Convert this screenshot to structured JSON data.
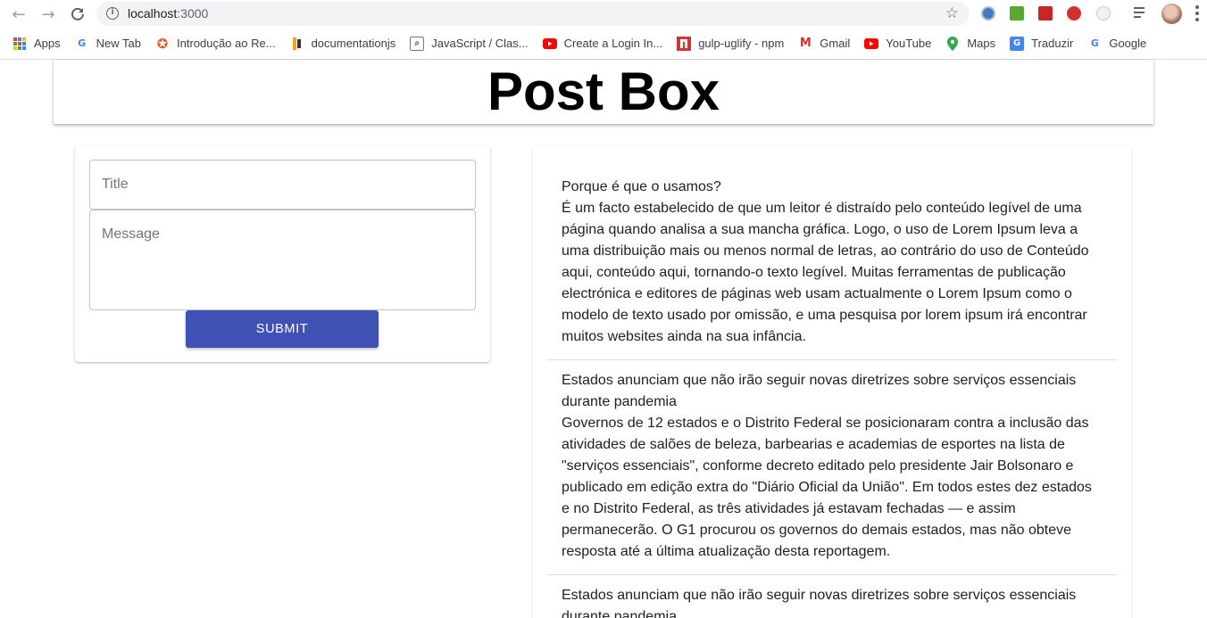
{
  "browser": {
    "url_host": "localhost",
    "url_port": ":3000",
    "bookmarks": [
      {
        "label": "Apps",
        "icon": "apps-grid-icon"
      },
      {
        "label": "New Tab",
        "icon": "google-icon"
      },
      {
        "label": "Introdução ao Re...",
        "icon": "auth0-icon"
      },
      {
        "label": "documentationjs",
        "icon": "documentationjs-icon"
      },
      {
        "label": "JavaScript / Clas...",
        "icon": "search-page-icon"
      },
      {
        "label": "Create a Login In...",
        "icon": "youtube-icon"
      },
      {
        "label": "gulp-uglify - npm",
        "icon": "npm-icon"
      },
      {
        "label": "Gmail",
        "icon": "gmail-icon"
      },
      {
        "label": "YouTube",
        "icon": "youtube-icon"
      },
      {
        "label": "Maps",
        "icon": "maps-icon"
      },
      {
        "label": "Traduzir",
        "icon": "translate-icon"
      },
      {
        "label": "Google",
        "icon": "google-icon"
      }
    ]
  },
  "header": {
    "title": "Post Box"
  },
  "form": {
    "title_placeholder": "Title",
    "message_placeholder": "Message",
    "submit_label": "SUBMIT",
    "accent_color": "#3f51b5"
  },
  "posts": [
    {
      "title": "Porque é que o usamos?",
      "body": "É um facto estabelecido de que um leitor é distraído pelo conteúdo legível de uma página quando analisa a sua mancha gráfica. Logo, o uso de Lorem Ipsum leva a uma distribuição mais ou menos normal de letras, ao contrário do uso de Conteúdo aqui, conteúdo aqui, tornando-o texto legível. Muitas ferramentas de publicação electrónica e editores de páginas web usam actualmente o Lorem Ipsum como o modelo de texto usado por omissão, e uma pesquisa por lorem ipsum irá encontrar muitos websites ainda na sua infância."
    },
    {
      "title": "Estados anunciam que não irão seguir novas diretrizes sobre serviços essenciais durante pandemia",
      "body": "Governos de 12 estados e o Distrito Federal se posicionaram contra a inclusão das atividades de salões de beleza, barbearias e academias de esportes na lista de \"serviços essenciais\", conforme decreto editado pelo presidente Jair Bolsonaro e publicado em edição extra do \"Diário Oficial da União\". Em todos estes dez estados e no Distrito Federal, as três atividades já estavam fechadas — e assim permanecerão. O G1 procurou os governos do demais estados, mas não obteve resposta até a última atualização desta reportagem."
    },
    {
      "title": "Estados anunciam que não irão seguir novas diretrizes sobre serviços essenciais durante pandemia",
      "body": ""
    }
  ]
}
